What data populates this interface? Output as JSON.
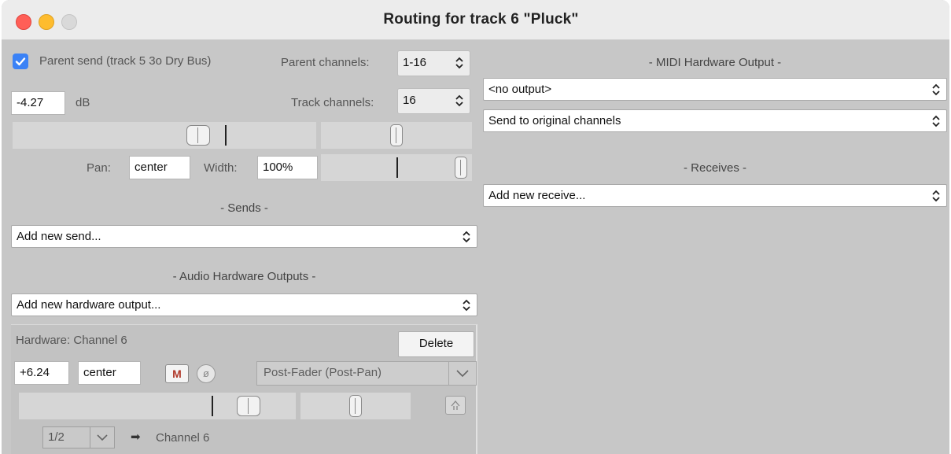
{
  "window": {
    "title": "Routing for track 6 \"Pluck\""
  },
  "parent": {
    "send_checked": true,
    "send_label": "Parent send (track 5 3o Dry Bus)",
    "channels_label": "Parent channels:",
    "channels_value": "1-16",
    "volume_value": "-4.27",
    "volume_unit": "dB",
    "track_channels_label": "Track channels:",
    "track_channels_value": "16",
    "pan_label": "Pan:",
    "pan_value": "center",
    "width_label": "Width:",
    "width_value": "100%"
  },
  "sends": {
    "header": "- Sends -",
    "add_placeholder": "Add new send..."
  },
  "audio_hw": {
    "header": "- Audio Hardware Outputs -",
    "add_placeholder": "Add new hardware output...",
    "hardware_label": "Hardware: Channel 6",
    "delete_label": "Delete",
    "volume_value": "+6.24",
    "pan_value": "center",
    "mute_label": "M",
    "phase_label": "ø",
    "mode_value": "Post-Fader (Post-Pan)",
    "channel_select": "1/2",
    "arrow_glyph": "➡",
    "dest_label": "Channel 6"
  },
  "midi_hw": {
    "header": "- MIDI Hardware Output -",
    "output_value": "<no output>",
    "channels_value": "Send to original channels"
  },
  "receives": {
    "header": "- Receives -",
    "add_placeholder": "Add new receive..."
  },
  "colors": {
    "accent": "#3b82f6",
    "close": "#ff5f57",
    "minimize": "#febc2e",
    "mute": "#b0392b"
  }
}
